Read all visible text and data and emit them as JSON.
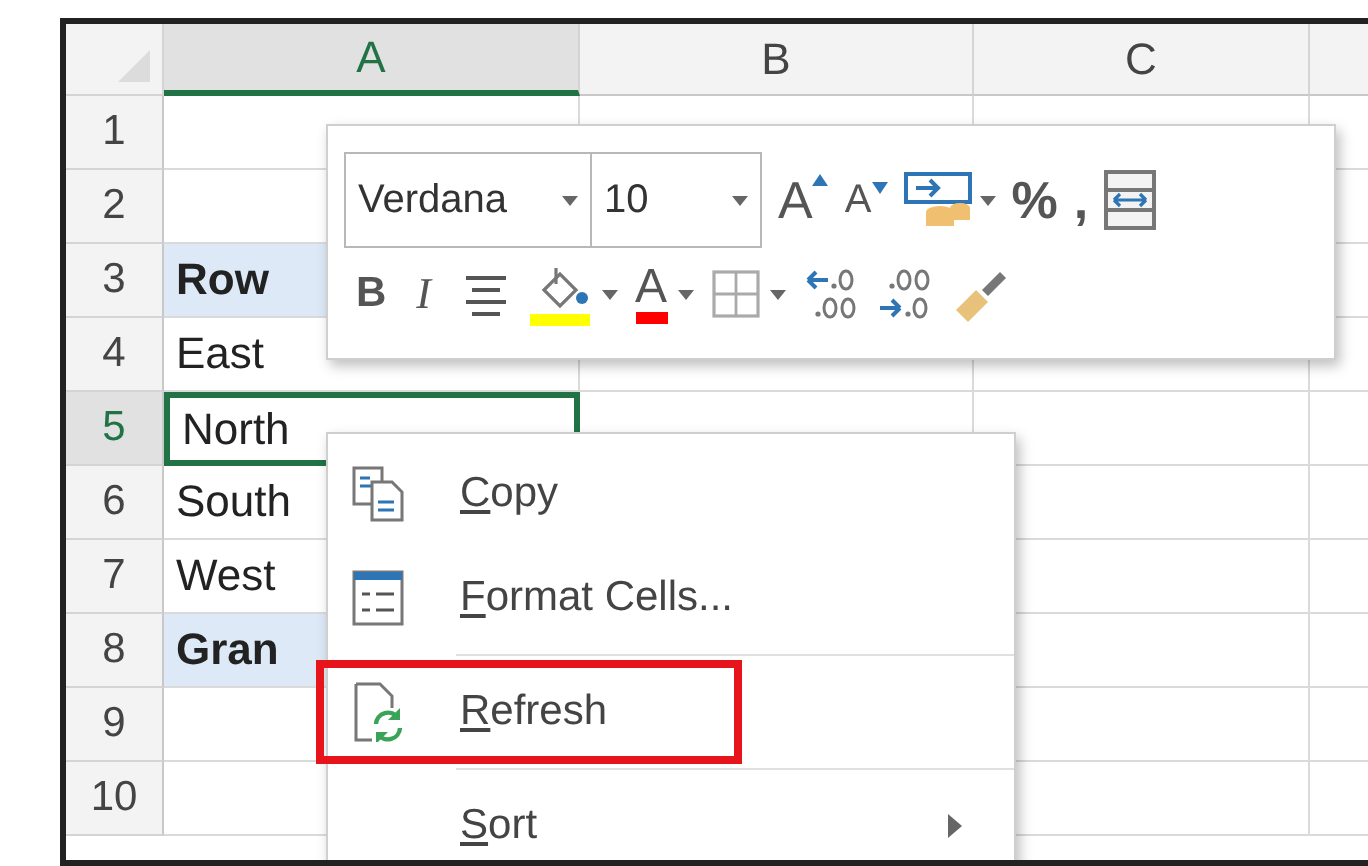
{
  "columns": [
    {
      "label": "A",
      "selected": true
    },
    {
      "label": "B",
      "selected": false
    },
    {
      "label": "C",
      "selected": false
    }
  ],
  "rows": [
    {
      "number": "1",
      "selected": false
    },
    {
      "number": "2",
      "selected": false
    },
    {
      "number": "3",
      "kind": "header",
      "selected": false,
      "label": "Row"
    },
    {
      "number": "4",
      "kind": "data",
      "selected": false,
      "label": "East"
    },
    {
      "number": "5",
      "kind": "data",
      "selected": true,
      "label": "North"
    },
    {
      "number": "6",
      "kind": "data",
      "selected": false,
      "label": "South"
    },
    {
      "number": "7",
      "kind": "data",
      "selected": false,
      "label": "West"
    },
    {
      "number": "8",
      "kind": "total",
      "selected": false,
      "label": "Gran"
    },
    {
      "number": "9",
      "selected": false
    },
    {
      "number": "10",
      "selected": false
    }
  ],
  "mini_toolbar": {
    "font": {
      "value": "Verdana"
    },
    "size": {
      "value": "10"
    },
    "row_1": [
      {
        "kind": "grow",
        "glyph": "A"
      },
      {
        "kind": "shrink",
        "glyph": "A"
      },
      {
        "kind": "styles",
        "dropdown": true
      },
      {
        "kind": "text",
        "glyph": "%"
      },
      {
        "kind": "text",
        "glyph": ","
      },
      {
        "kind": "wrap"
      }
    ],
    "row_2": [
      {
        "kind": "bold",
        "glyph": "B"
      },
      {
        "kind": "italic",
        "glyph": "I"
      },
      {
        "kind": "align"
      },
      {
        "kind": "fill",
        "dropdown": true
      },
      {
        "kind": "fontcolor",
        "glyph": "A",
        "dropdown": true
      },
      {
        "kind": "borders",
        "dropdown": true
      },
      {
        "kind": "inc-decimal"
      },
      {
        "kind": "dec-decimal"
      },
      {
        "kind": "painter"
      }
    ]
  },
  "context_menu": [
    {
      "kind": "copy",
      "mnemonic": "C",
      "rest": "opy"
    },
    {
      "kind": "format",
      "mnemonic": "F",
      "rest": "ormat Cells...",
      "divider_after": true
    },
    {
      "kind": "refresh",
      "mnemonic": "R",
      "rest": "efresh",
      "highlighted": true,
      "divider_after": true
    },
    {
      "kind": "sort",
      "mnemonic": "S",
      "rest": "ort",
      "submenu": true
    }
  ]
}
